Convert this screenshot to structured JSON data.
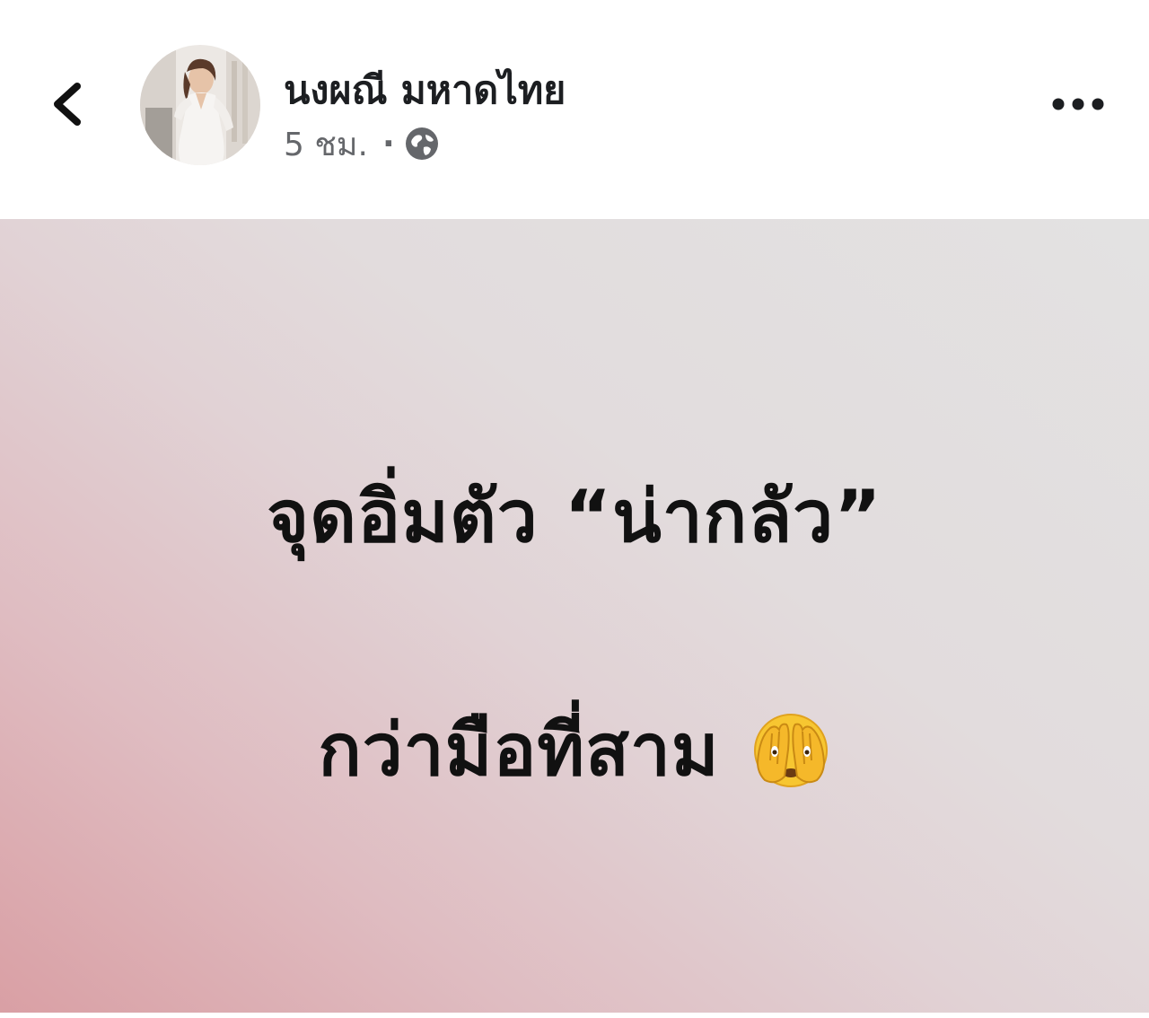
{
  "header": {
    "author_name": "นงผณี มหาดไทย",
    "time": "5 ชม.",
    "separator": "·",
    "privacy_icon": "globe-icon",
    "back_icon": "chevron-left-icon",
    "more_icon": "more-horizontal-icon"
  },
  "post": {
    "line1": "จุดอิ่มตัว “น่ากลัว”",
    "line2": "กว่ามือที่สาม",
    "emoji_icon": "face-with-peeking-eye-emoji",
    "background_colors": [
      "#d99fa4",
      "#e1d2d5",
      "#e3e2e2"
    ]
  }
}
